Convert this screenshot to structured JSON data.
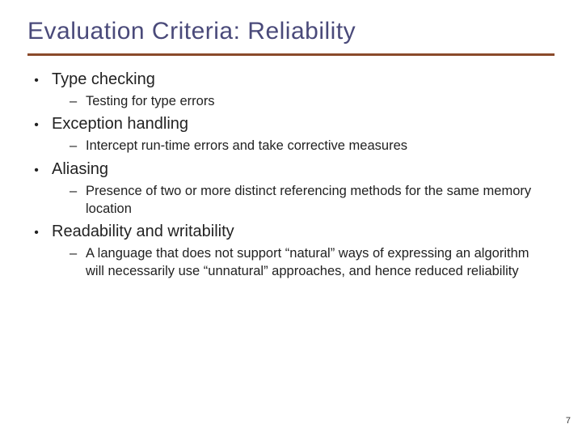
{
  "slide": {
    "title": "Evaluation Criteria: Reliability",
    "page_number": "7",
    "bullets": [
      {
        "label": "Type checking",
        "subs": [
          "Testing for type errors"
        ]
      },
      {
        "label": "Exception handling",
        "subs": [
          "Intercept run-time errors and take corrective measures"
        ]
      },
      {
        "label": "Aliasing",
        "subs": [
          "Presence of two or more distinct referencing methods for the same memory location"
        ]
      },
      {
        "label": "Readability and writability",
        "subs": [
          "A language that does not support “natural” ways of expressing an algorithm will necessarily use “unnatural” approaches, and hence reduced reliability"
        ]
      }
    ]
  }
}
